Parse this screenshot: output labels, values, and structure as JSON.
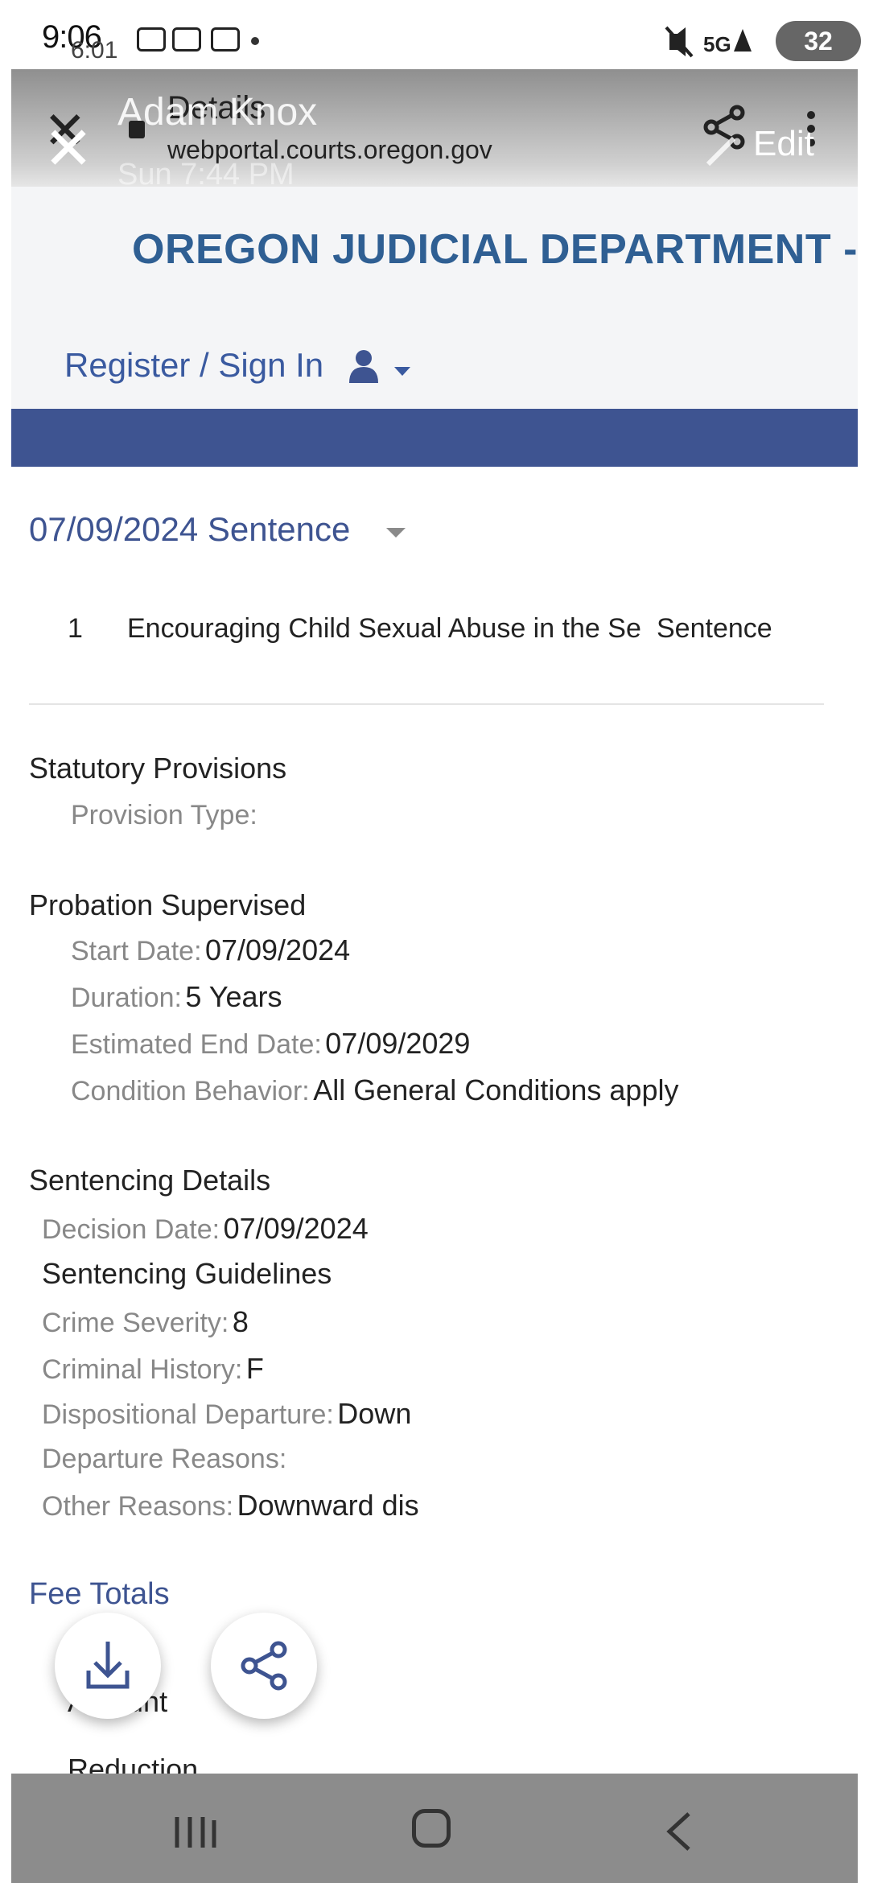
{
  "status_bar": {
    "time": "9:06",
    "time_secondary": "6:01",
    "battery": "32"
  },
  "overlay": {
    "sender": "Adam Knox",
    "timestamp": "Sun 7:44 PM",
    "page_heading": "Details",
    "url": "webportal.courts.oregon.gov",
    "edit_label": "Edit",
    "close_glyph": "✕"
  },
  "site": {
    "title": "OREGON JUDICIAL DEPARTMENT -",
    "signin": "Register / Sign In"
  },
  "sentence": {
    "heading": "07/09/2024 Sentence",
    "charge": {
      "number": "1",
      "description": "Encouraging Child Sexual Abuse in the Se",
      "type": "Sentence"
    }
  },
  "statutory": {
    "title": "Statutory Provisions",
    "provision_type_label": "Provision Type:"
  },
  "probation": {
    "title": "Probation Supervised",
    "start_date_label": "Start Date:",
    "start_date": "07/09/2024",
    "duration_label": "Duration:",
    "duration": "5 Years",
    "end_date_label": "Estimated End Date:",
    "end_date": "07/09/2029",
    "condition_label": "Condition Behavior:",
    "condition": "All General Conditions apply"
  },
  "sentencing": {
    "title": "Sentencing Details",
    "decision_date_label": "Decision Date:",
    "decision_date": "07/09/2024",
    "guidelines_title": "Sentencing Guidelines",
    "crime_severity_label": "Crime Severity:",
    "crime_severity": "8",
    "criminal_history_label": "Criminal History:",
    "criminal_history": "F",
    "dispositional_label": "Dispositional Departure:",
    "dispositional": "Down",
    "departure_reasons_label": "Departure Reasons:",
    "other_reasons_label": "Other Reasons:",
    "other_reasons": "Downward dis"
  },
  "fees": {
    "title": "Fee Totals",
    "amount_label": "Amount",
    "reduction_label": "Reduction"
  },
  "icons": {
    "download": "download-icon",
    "share": "share-icon",
    "user": "user-icon",
    "nav_recents": "recents-icon",
    "nav_home": "home-icon",
    "nav_back": "back-icon"
  },
  "colors": {
    "brand_blue": "#2f5f93",
    "band_blue": "#3e5491",
    "link_blue": "#3a5aa0"
  }
}
